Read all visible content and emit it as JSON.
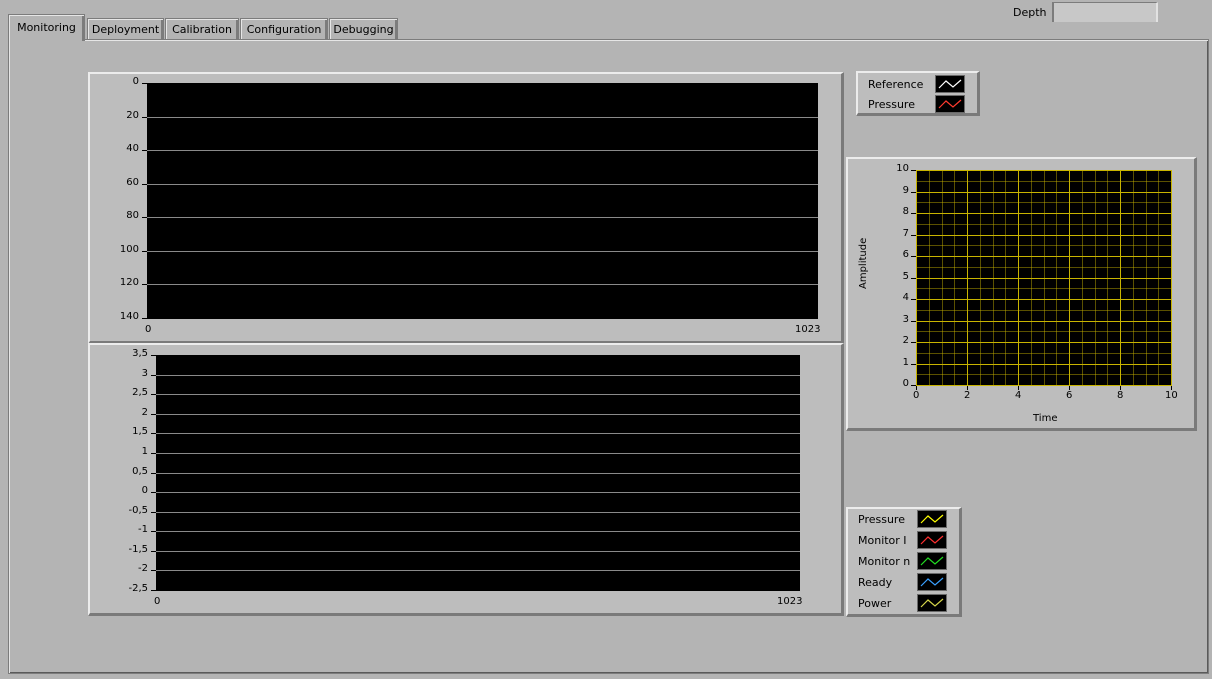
{
  "tabs": [
    {
      "label": "Monitoring",
      "active": true
    },
    {
      "label": "Deployment",
      "active": false
    },
    {
      "label": "Calibration",
      "active": false
    },
    {
      "label": "Configuration",
      "active": false
    },
    {
      "label": "Debugging",
      "active": false
    }
  ],
  "depth": {
    "label": "Depth",
    "value": ""
  },
  "chart_top": {
    "type": "line",
    "y_ticks": [
      "0",
      "20",
      "40",
      "60",
      "80",
      "100",
      "120",
      "140"
    ],
    "x_ticks": [
      "0",
      "1023"
    ],
    "ylim": [
      140,
      0
    ],
    "xlim": [
      0,
      1023
    ],
    "grid": true,
    "series": []
  },
  "chart_bottom": {
    "type": "line",
    "y_ticks": [
      "3,5",
      "3",
      "2,5",
      "2",
      "1,5",
      "1",
      "0,5",
      "0",
      "-0,5",
      "-1",
      "-1,5",
      "-2",
      "-2,5"
    ],
    "x_ticks": [
      "0",
      "1023"
    ],
    "ylim": [
      -2.5,
      3.5
    ],
    "xlim": [
      0,
      1023
    ],
    "grid": true,
    "series": []
  },
  "chart_right": {
    "type": "line",
    "xlabel": "Time",
    "ylabel": "Amplitude",
    "y_ticks": [
      "10",
      "9",
      "8",
      "7",
      "6",
      "5",
      "4",
      "3",
      "2",
      "1",
      "0"
    ],
    "x_ticks": [
      "0",
      "2",
      "4",
      "6",
      "8",
      "10"
    ],
    "xlim": [
      0,
      10
    ],
    "ylim": [
      0,
      10
    ],
    "grid": true,
    "series": []
  },
  "legend_top": [
    {
      "label": "Reference",
      "color": "#ffffff"
    },
    {
      "label": "Pressure",
      "color": "#ff3b2f"
    }
  ],
  "legend_bottom": [
    {
      "label": "Pressure",
      "color": "#ffff00"
    },
    {
      "label": "Monitor I",
      "color": "#ff3030"
    },
    {
      "label": "Monitor n",
      "color": "#22dd22"
    },
    {
      "label": "Ready",
      "color": "#3aa0ff"
    },
    {
      "label": "Power",
      "color": "#d6d64a"
    }
  ],
  "colors": {
    "background": "#b4b4b4",
    "plot_bg": "#000000",
    "grid_gray": "#8a8a8a",
    "grid_yellow": "#c8b400"
  }
}
